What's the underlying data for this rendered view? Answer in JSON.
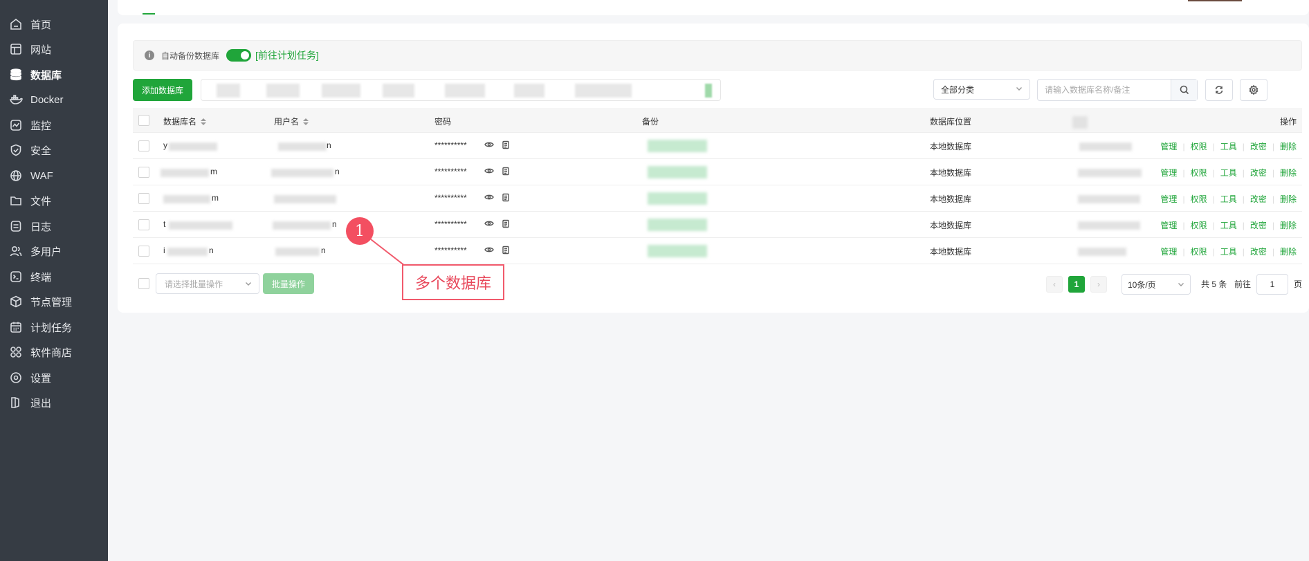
{
  "sidebar": {
    "items": [
      {
        "label": "首页",
        "icon": "home-icon"
      },
      {
        "label": "网站",
        "icon": "website-icon"
      },
      {
        "label": "数据库",
        "icon": "database-icon",
        "active": true
      },
      {
        "label": "Docker",
        "icon": "docker-icon"
      },
      {
        "label": "监控",
        "icon": "monitor-icon"
      },
      {
        "label": "安全",
        "icon": "shield-icon"
      },
      {
        "label": "WAF",
        "icon": "globe-icon"
      },
      {
        "label": "文件",
        "icon": "folder-icon"
      },
      {
        "label": "日志",
        "icon": "log-icon"
      },
      {
        "label": "多用户",
        "icon": "users-icon"
      },
      {
        "label": "终端",
        "icon": "terminal-icon"
      },
      {
        "label": "节点管理",
        "icon": "cube-icon"
      },
      {
        "label": "计划任务",
        "icon": "calendar-icon"
      },
      {
        "label": "软件商店",
        "icon": "apps-icon"
      },
      {
        "label": "设置",
        "icon": "settings-icon"
      },
      {
        "label": "退出",
        "icon": "logout-icon"
      }
    ]
  },
  "tip": {
    "text": "自动备份数据库",
    "link": "[前往计划任务]"
  },
  "toolbar": {
    "add_label": "添加数据库",
    "category_value": "全部分类",
    "search_placeholder": "请输入数据库名称/备注"
  },
  "table": {
    "headers": {
      "name": "数据库名",
      "user": "用户名",
      "password": "密码",
      "backup": "备份",
      "location": "数据库位置",
      "ops": "操作"
    },
    "rows": [
      {
        "name": "y",
        "name_tail": "",
        "user": "",
        "user_tail": "n",
        "password": "**********",
        "location": "本地数据库"
      },
      {
        "name": "",
        "name_tail": "m",
        "user": "",
        "user_tail": "n",
        "password": "**********",
        "location": "本地数据库"
      },
      {
        "name": "",
        "name_tail": "m",
        "user": "",
        "user_tail": "",
        "password": "**********",
        "location": "本地数据库"
      },
      {
        "name": "t",
        "name_tail": "",
        "user": "",
        "user_tail": "n",
        "password": "**********",
        "location": "本地数据库"
      },
      {
        "name": "i",
        "name_tail": "n",
        "user": "",
        "user_tail": "n",
        "password": "**********",
        "location": "本地数据库"
      }
    ],
    "ops": [
      "管理",
      "权限",
      "工具",
      "改密",
      "删除"
    ]
  },
  "footer": {
    "batch_placeholder": "请选择批量操作",
    "batch_button": "批量操作",
    "current_page": "1",
    "page_size": "10条/页",
    "total": "共 5 条",
    "goto": "前往",
    "goto_value": "1",
    "page_unit": "页"
  },
  "annotation": {
    "number": "1",
    "label": "多个数据库"
  },
  "colors": {
    "accent": "#20a53a",
    "sidebar_bg": "#363c44",
    "annotation": "#f34f61"
  }
}
